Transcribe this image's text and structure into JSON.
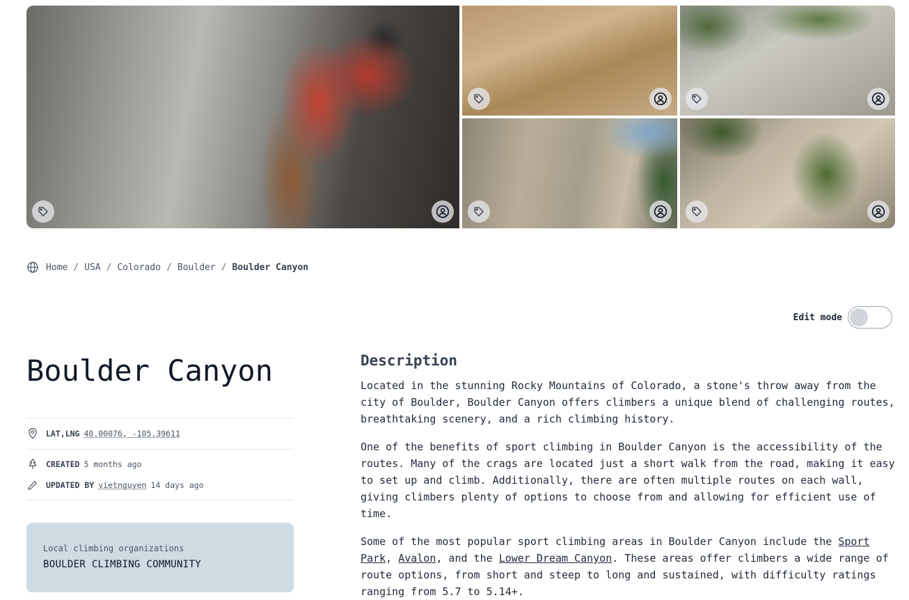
{
  "gallery": {
    "photos": [
      {
        "id": "main",
        "tag_icon": "tag-icon",
        "user_icon": "user-circle-icon"
      },
      {
        "id": "top-middle",
        "tag_icon": "tag-icon",
        "user_icon": "user-circle-icon"
      },
      {
        "id": "top-right",
        "tag_icon": "tag-icon",
        "user_icon": "user-circle-icon"
      },
      {
        "id": "bottom-middle",
        "tag_icon": "tag-icon",
        "user_icon": "user-circle-icon"
      },
      {
        "id": "bottom-right",
        "tag_icon": "tag-icon",
        "user_icon": "user-circle-icon"
      }
    ]
  },
  "breadcrumb": {
    "icon": "globe-icon",
    "items": [
      "Home",
      "USA",
      "Colorado",
      "Boulder"
    ],
    "current": "Boulder Canyon",
    "separator": "/"
  },
  "edit_mode": {
    "label": "Edit mode",
    "enabled": false
  },
  "area": {
    "title": "Boulder Canyon",
    "latlng_label": "LAT,LNG",
    "latlng_value": "40.00076, -105.39611",
    "created_label": "CREATED",
    "created_value": "5 months ago",
    "updated_label": "UPDATED BY",
    "updated_user": "vietnguyen",
    "updated_value": "14 days ago"
  },
  "organizations": {
    "heading": "Local climbing organizations",
    "name": "BOULDER CLIMBING COMMUNITY"
  },
  "description": {
    "title": "Description",
    "p1": "Located in the stunning Rocky Mountains of Colorado, a stone's throw away from the city of Boulder, Boulder Canyon offers climbers a unique blend of challenging routes, breathtaking scenery, and a rich climbing history.",
    "p2": "One of the benefits of sport climbing in Boulder Canyon is the accessibility of the routes. Many of the crags are located just a short walk from the road, making it easy to set up and climb. Additionally, there are often multiple routes on each wall, giving climbers plenty of options to choose from and allowing for efficient use of time.",
    "p3_a": "Some of the most popular sport climbing areas in Boulder Canyon include the ",
    "p3_link1": "Sport Park",
    "p3_b": ", ",
    "p3_link2": "Avalon",
    "p3_c": ", and the ",
    "p3_link3": "Lower Dream Canyon",
    "p3_d": ". These areas offer climbers a wide range of route options, from short and steep to long and sustained, with difficulty ratings ranging from 5.7 to 5.14+."
  },
  "colors": {
    "org_card_bg": "#cddbe2",
    "text": "#1f2937"
  }
}
